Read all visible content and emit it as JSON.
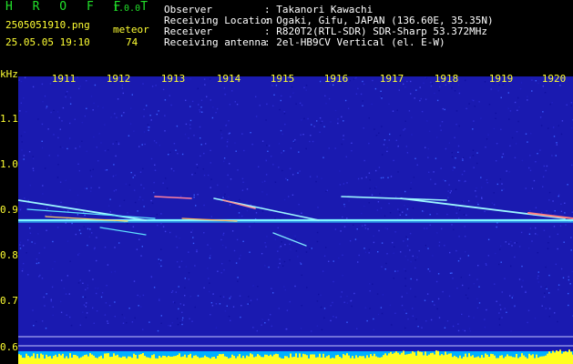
{
  "header": {
    "app_name": "H R O F F T",
    "version": "1.0.0",
    "filename": "2505051910.png",
    "datetime": "25.05.05 19:10",
    "meteor_label": "meteor",
    "meteor_count": "74",
    "observer_label": "Observer",
    "observer_value": ": Takanori Kawachi",
    "location_label": "Receiving Location",
    "location_value": ": Ogaki, Gifu, JAPAN (136.60E, 35.35N)",
    "receiver_label": "Receiver",
    "receiver_value": ": R820T2(RTL-SDR) SDR-Sharp 53.372MHz",
    "antenna_label": "Receiving antenna",
    "antenna_value": ": 2el-HB9CV Vertical (el. E-W)"
  },
  "axes": {
    "y_unit": "kHz",
    "y_ticks": [
      "1.1",
      "1.0",
      "0.9",
      "0.8",
      "0.7",
      "0.6"
    ],
    "x_ticks": [
      "1911",
      "1912",
      "1913",
      "1914",
      "1915",
      "1916",
      "1917",
      "1918",
      "1919",
      "1920"
    ]
  },
  "colors": {
    "background": "#000000",
    "spectrogram_bg": "#1a1ab0",
    "label_yellow": "#ffff33",
    "label_green": "#22e02a",
    "label_white": "#ffffff"
  }
}
